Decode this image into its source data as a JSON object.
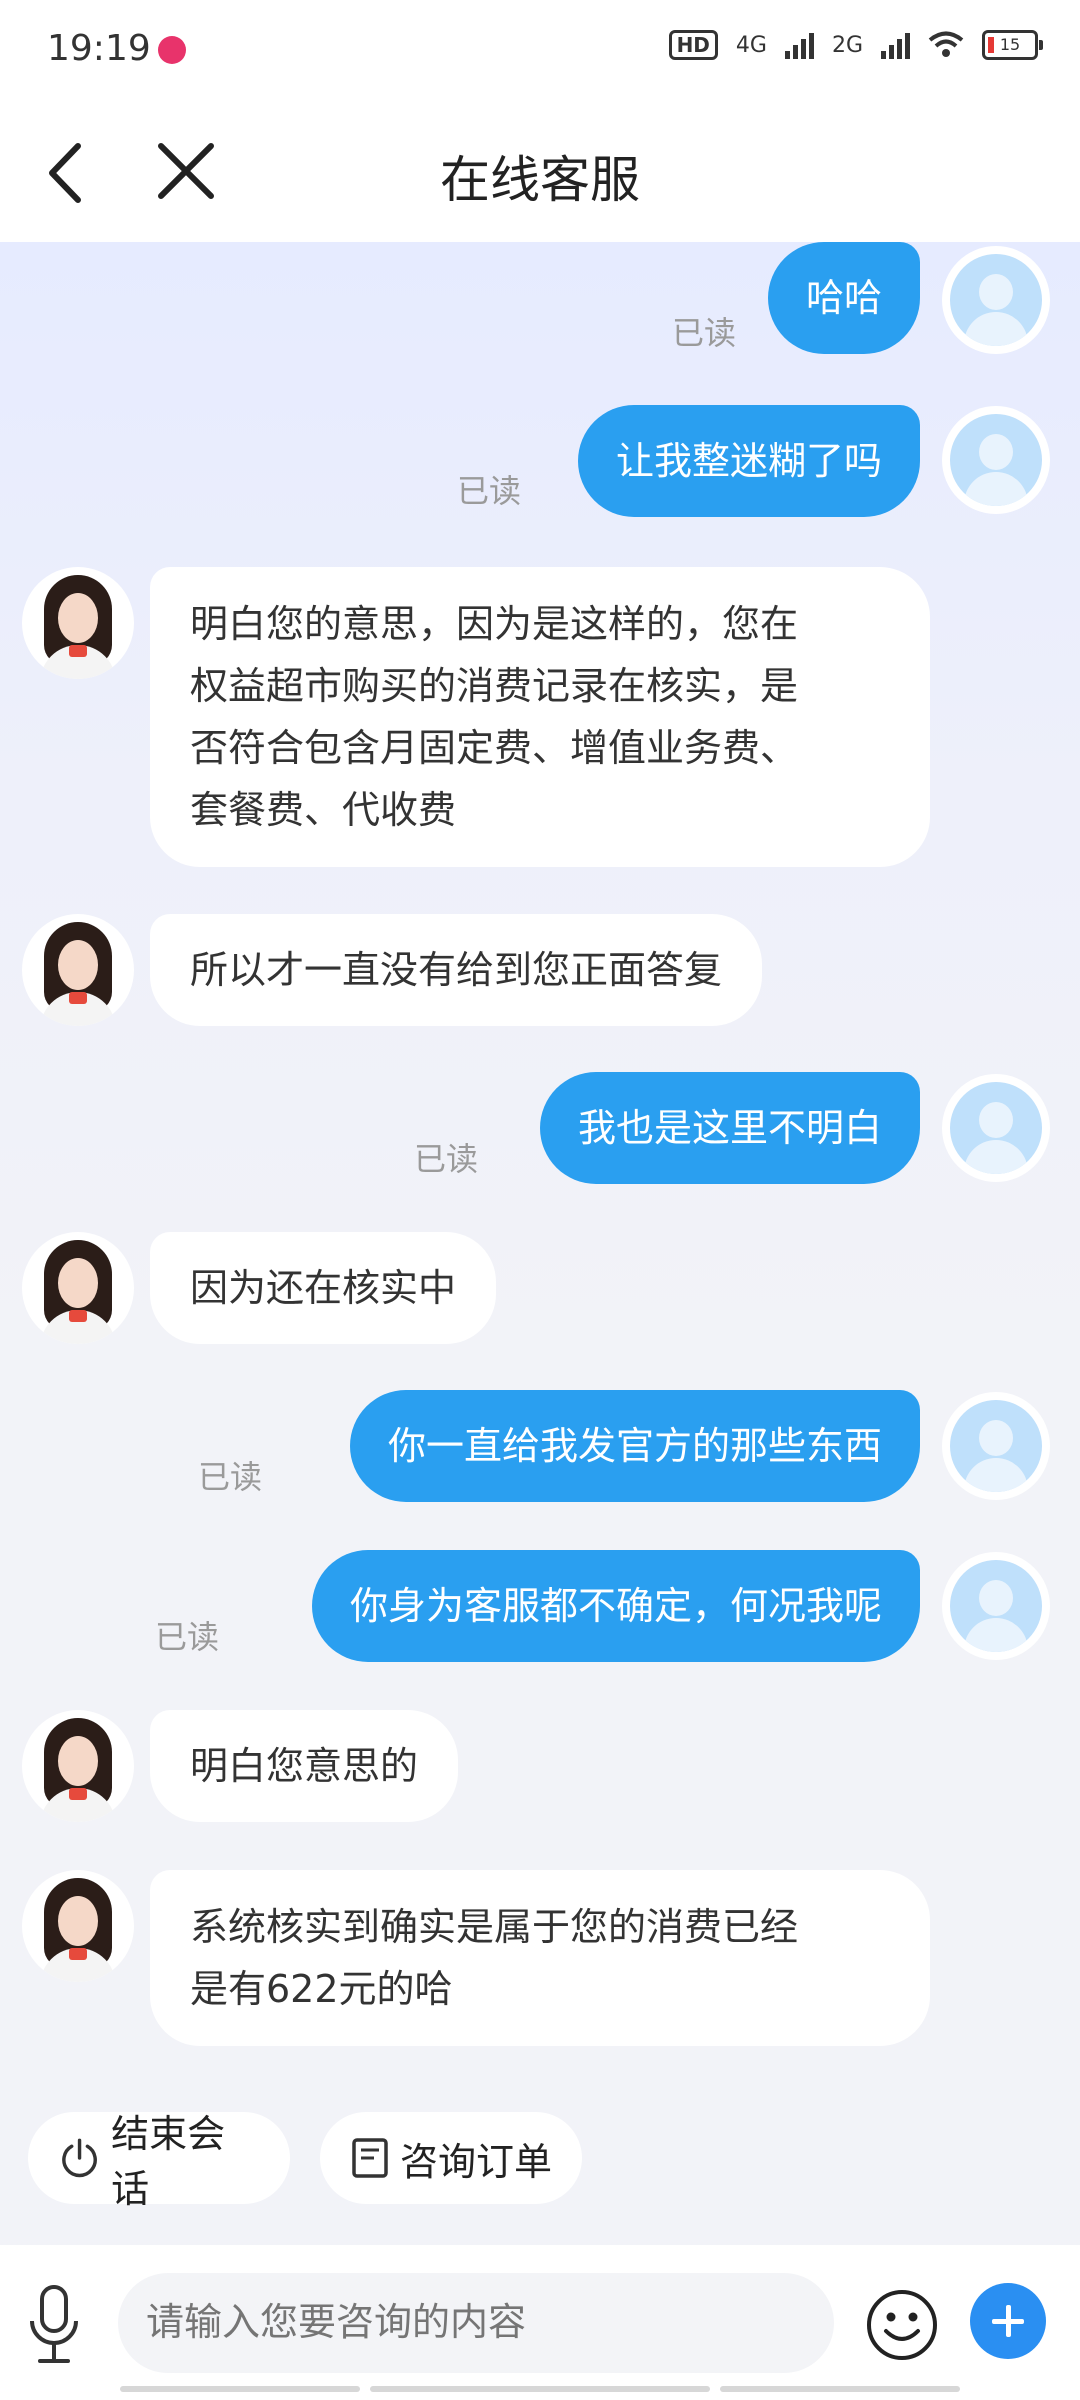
{
  "status_bar": {
    "time": "19:19",
    "network1": "4G",
    "network2": "2G",
    "hd": "HD",
    "battery": "15"
  },
  "header": {
    "title": "在线客服"
  },
  "messages": [
    {
      "from": "user",
      "text": "哈哈",
      "status": "已读"
    },
    {
      "from": "user",
      "text": "让我整迷糊了吗",
      "status": "已读"
    },
    {
      "from": "agent",
      "lines": [
        "明白您的意思，因为是这样的，您在",
        "权益超市购买的消费记录在核实，是",
        "否符合包含月固定费、增值业务费、",
        "套餐费、代收费"
      ]
    },
    {
      "from": "agent",
      "text": "所以才一直没有给到您正面答复"
    },
    {
      "from": "user",
      "text": "我也是这里不明白",
      "status": "已读"
    },
    {
      "from": "agent",
      "text": "因为还在核实中"
    },
    {
      "from": "user",
      "text": "你一直给我发官方的那些东西",
      "status": "已读"
    },
    {
      "from": "user",
      "text": "你身为客服都不确定，何况我呢",
      "status": "已读"
    },
    {
      "from": "agent",
      "text": "明白您意思的"
    },
    {
      "from": "agent",
      "lines": [
        "系统核实到确实是属于您的消费已经",
        "是有622元的哈"
      ]
    }
  ],
  "quick_actions": [
    {
      "label": "结束会话",
      "icon": "power-icon"
    },
    {
      "label": "咨询订单",
      "icon": "document-icon"
    }
  ],
  "input": {
    "placeholder": "请输入您要咨询的内容"
  },
  "colors": {
    "user_bubble": "#2a9ff0",
    "accent": "#2a8ff2"
  }
}
